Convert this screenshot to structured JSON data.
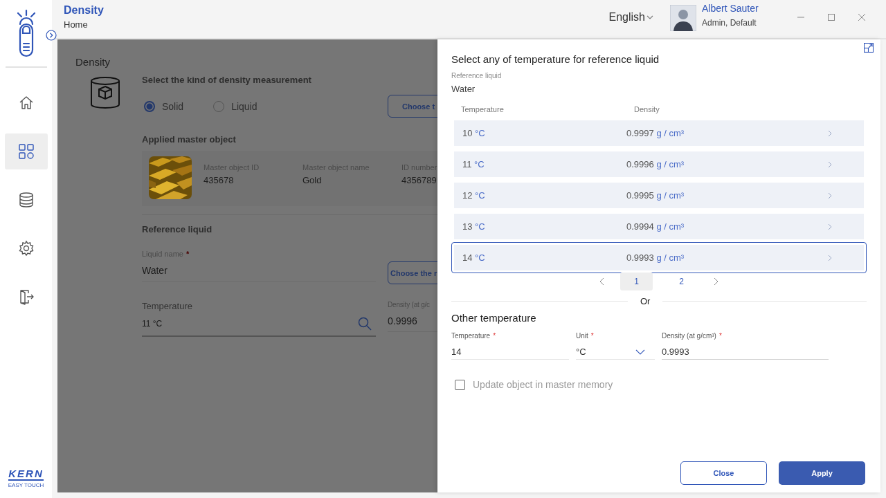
{
  "app": {
    "title": "Density",
    "breadcrumb": "Home"
  },
  "header": {
    "language": "English",
    "user": {
      "name": "Albert Sauter",
      "role": "Admin, Default"
    }
  },
  "sidebar": {
    "items": [
      {
        "selected": false
      },
      {
        "selected": true
      },
      {
        "selected": false
      },
      {
        "selected": false
      },
      {
        "selected": false
      }
    ],
    "brand": {
      "name": "KERN",
      "tagline": "EASY TOUCH"
    }
  },
  "page": {
    "title": "Density",
    "measurement_prompt": "Select the kind of density measurement",
    "options": [
      {
        "label": "Solid",
        "selected": true
      },
      {
        "label": "Liquid",
        "selected": false
      }
    ],
    "choose_button": "Choose t",
    "master_object": {
      "heading": "Applied master object",
      "fields": [
        {
          "label": "Master object ID",
          "value": "435678"
        },
        {
          "label": "Master object name",
          "value": "Gold"
        },
        {
          "label": "ID number",
          "value": "4356789"
        }
      ]
    },
    "reference": {
      "heading": "Reference liquid",
      "liquid": {
        "label": "Liquid name",
        "required_mark": "*",
        "value": "Water"
      },
      "choose_button": "Choose the r",
      "temperature": {
        "label": "Temperature",
        "value": "11 °C"
      },
      "density": {
        "label": "Density (at g/c",
        "value": "0.9996"
      }
    }
  },
  "drawer": {
    "title": "Select any of temperature for reference liquid",
    "reference_label": "Reference liquid",
    "reference_value": "Water",
    "columns": [
      "Temperature",
      "Density"
    ],
    "rows": [
      {
        "temperature": "10",
        "temperature_unit": "°C",
        "density": "0.9997",
        "density_unit": "g / cm³",
        "selected": false
      },
      {
        "temperature": "11",
        "temperature_unit": "°C",
        "density": "0.9996",
        "density_unit": "g / cm³",
        "selected": false
      },
      {
        "temperature": "12",
        "temperature_unit": "°C",
        "density": "0.9995",
        "density_unit": "g / cm³",
        "selected": false
      },
      {
        "temperature": "13",
        "temperature_unit": "°C",
        "density": "0.9994",
        "density_unit": "g / cm³",
        "selected": false
      },
      {
        "temperature": "14",
        "temperature_unit": "°C",
        "density": "0.9993",
        "density_unit": "g / cm³",
        "selected": true
      }
    ],
    "pagination": {
      "pages": [
        {
          "label": "1",
          "selected": true
        },
        {
          "label": "2",
          "selected": false
        }
      ]
    },
    "divider": "Or",
    "other": {
      "heading": "Other temperature",
      "fields": [
        {
          "label": "Temperature",
          "required_mark": "*",
          "value": "14",
          "kind": "text"
        },
        {
          "label": "Unit",
          "required_mark": "*",
          "value": "°C",
          "kind": "select"
        },
        {
          "label": "Density (at g/cm³)",
          "required_mark": "*",
          "value": "0.9993",
          "kind": "text"
        }
      ]
    },
    "checkbox": {
      "label": "Update object in master memory",
      "checked": false
    },
    "buttons": [
      {
        "label": "Close",
        "kind": "secondary"
      },
      {
        "label": "Apply",
        "kind": "primary"
      }
    ]
  }
}
